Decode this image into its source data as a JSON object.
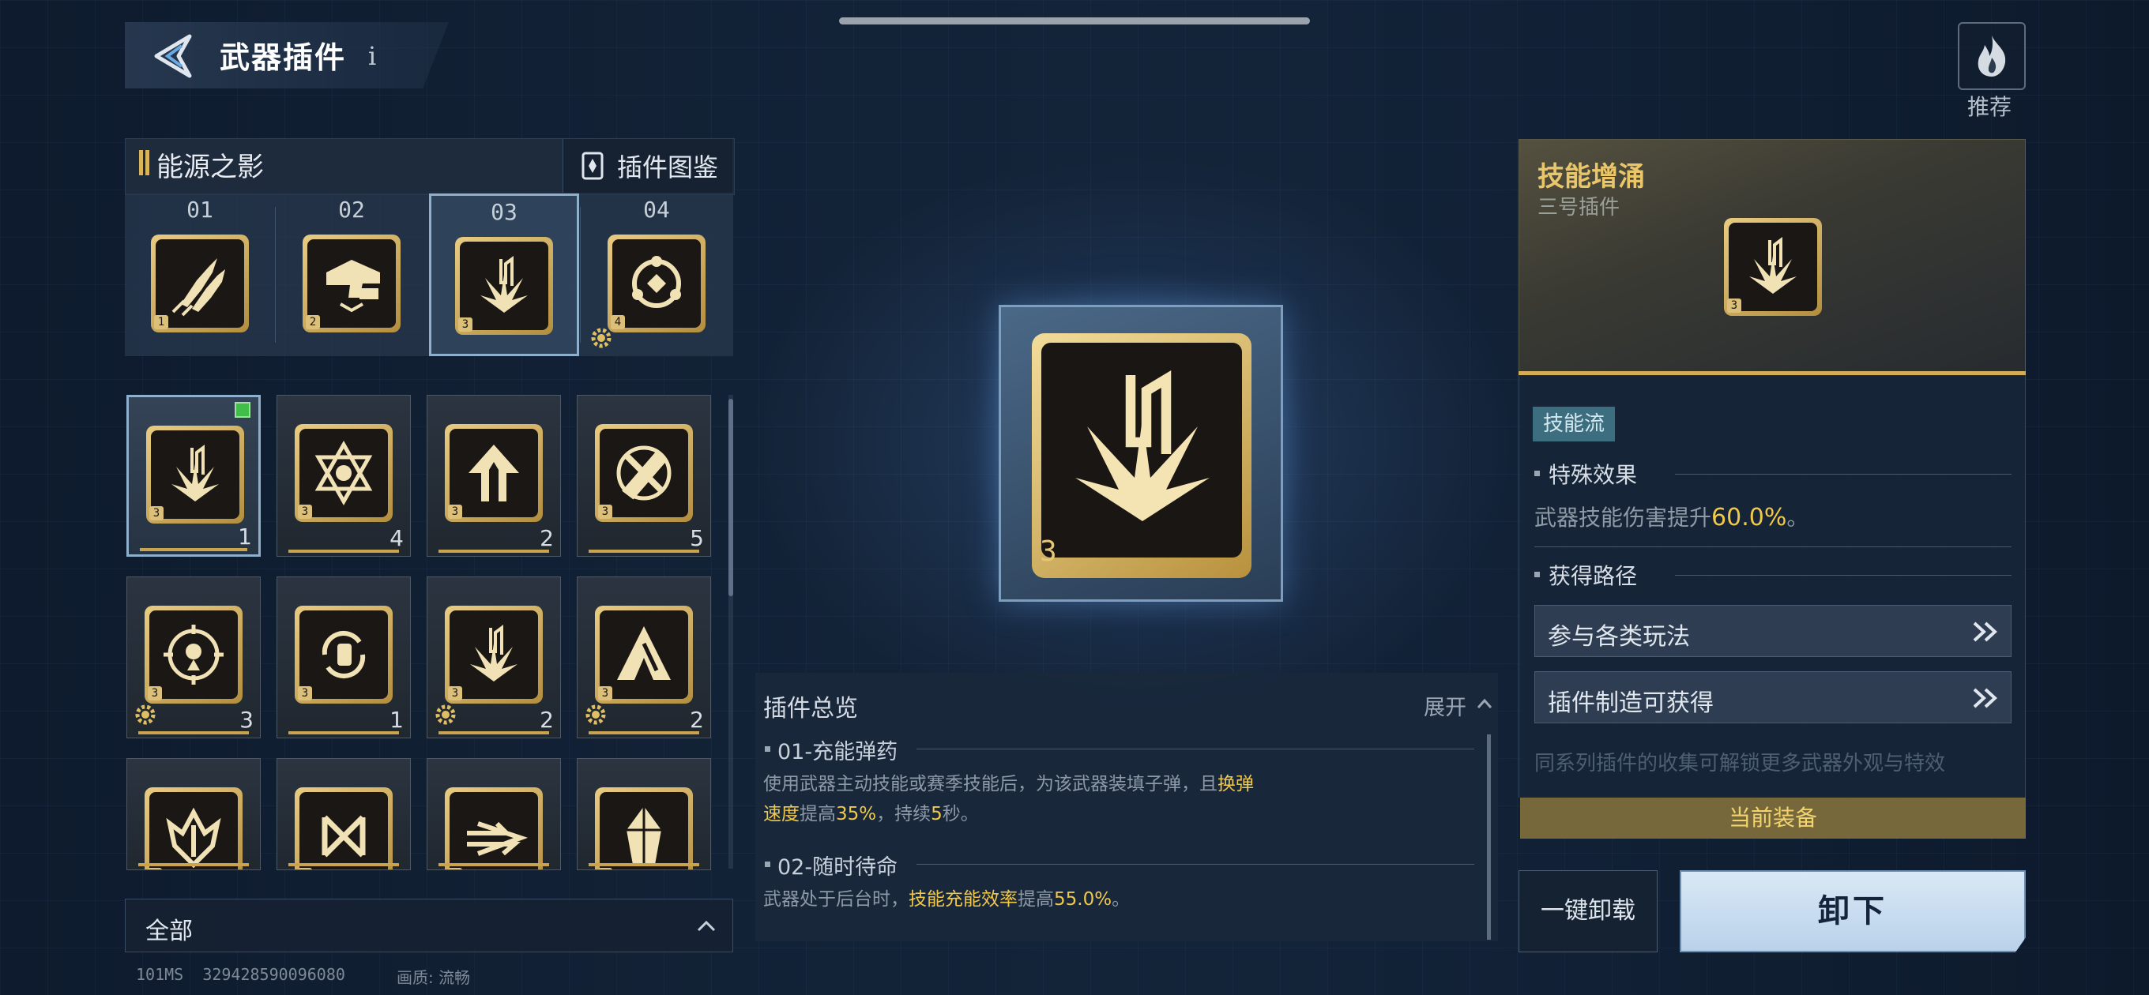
{
  "header": {
    "title": "武器插件",
    "info": "i"
  },
  "recommend": {
    "label": "推荐"
  },
  "set_panel": {
    "name": "能源之影",
    "codex_label": "插件图鉴",
    "slots": [
      {
        "num": "01",
        "icon": "bullets-icon",
        "rank": "1"
      },
      {
        "num": "02",
        "icon": "gun-icon",
        "rank": "2"
      },
      {
        "num": "03",
        "icon": "skill-surge-icon",
        "rank": "3",
        "selected": true
      },
      {
        "num": "04",
        "icon": "orbit-ring-icon",
        "rank": "4"
      }
    ]
  },
  "inventory": {
    "tiles": [
      {
        "icon": "skill-surge-icon",
        "count": "1",
        "rank": "3",
        "selected": true,
        "equipped": true,
        "gear": false
      },
      {
        "icon": "hexagram-icon",
        "count": "4",
        "rank": "3",
        "gear": false
      },
      {
        "icon": "up-arrow-icon",
        "count": "2",
        "rank": "3",
        "gear": false
      },
      {
        "icon": "crossed-bullets-icon",
        "count": "5",
        "rank": "3",
        "gear": false
      },
      {
        "icon": "target-icon",
        "count": "3",
        "rank": "3",
        "gear": true
      },
      {
        "icon": "hand-cycle-icon",
        "count": "1",
        "rank": "3",
        "gear": false
      },
      {
        "icon": "skill-surge-icon",
        "count": "2",
        "rank": "3",
        "gear": true
      },
      {
        "icon": "peak-arrow-icon",
        "count": "2",
        "rank": "3",
        "gear": true
      },
      {
        "icon": "wing-shield-icon",
        "count": "",
        "rank": "3",
        "gear": false
      },
      {
        "icon": "knot-icon",
        "count": "",
        "rank": "3",
        "gear": false
      },
      {
        "icon": "dash-icon",
        "count": "",
        "rank": "3",
        "gear": false
      },
      {
        "icon": "crystal-icon",
        "count": "",
        "rank": "3",
        "gear": false
      }
    ]
  },
  "filter": {
    "label": "全部"
  },
  "footer": {
    "latency": "101MS",
    "uid": "329428590096080",
    "quality_label": "画质:",
    "quality_value": "流畅"
  },
  "center": {
    "rank": "3"
  },
  "overview": {
    "title": "插件总览",
    "expand_label": "展开",
    "sections": [
      {
        "heading": "01-充能弹药",
        "text_a": "使用武器主动技能或赛季技能后，为该武器装填子弹，且",
        "hl_a": "换弹",
        "hl_b": "速度",
        "text_b": "提高",
        "hl_c": "35%",
        "text_c": "，持续",
        "hl_d": "5",
        "text_d": "秒。"
      },
      {
        "heading": "02-随时待命",
        "text_a": "武器处于后台时，",
        "hl_a": "技能充能效率",
        "text_b": "提高",
        "hl_b": "55.0%",
        "text_c": "。"
      }
    ]
  },
  "detail": {
    "title": "技能增涌",
    "subtitle": "三号插件",
    "rank": "3",
    "badge": "技能流",
    "special_heading": "特殊效果",
    "effect_text": "武器技能伤害提升",
    "effect_value": "60.0%",
    "effect_end": "。",
    "route_heading": "获得路径",
    "routes": [
      "参与各类玩法",
      "插件制造可获得"
    ],
    "faded_text": "同系列插件的收集可解锁更多武器外观与特效",
    "equip_status": "当前装备"
  },
  "actions": {
    "unload_all": "一键卸载",
    "unload": "卸下"
  },
  "colors": {
    "gold": "#d2ad56",
    "highlight": "#f0c84a",
    "equipped": "#3fbf4a",
    "badge": "#3c6e80"
  }
}
